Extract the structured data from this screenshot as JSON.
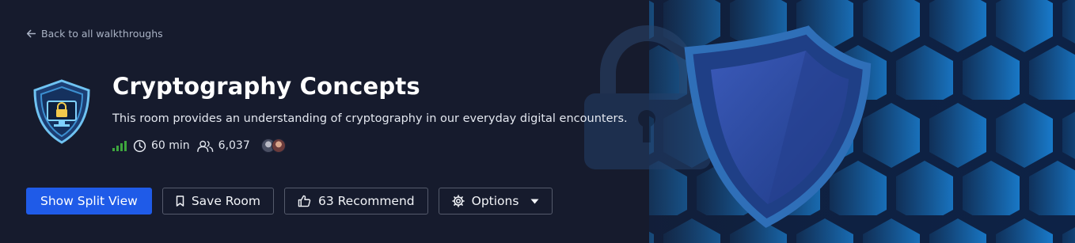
{
  "back_link": {
    "label": "Back to all walkthroughs",
    "icon": "arrow-left-icon"
  },
  "room": {
    "title": "Cryptography Concepts",
    "description": "This room provides an understanding of cryptography in our everyday digital encounters.",
    "difficulty_icon": "signal-bars-icon",
    "duration": "60 min",
    "users_count": "6,037",
    "duration_icon": "clock-icon",
    "users_icon": "users-icon"
  },
  "actions": {
    "split_view": "Show Split View",
    "save_room": "Save Room",
    "recommend": "63 Recommend",
    "options": "Options"
  },
  "colors": {
    "background": "#161b2d",
    "primary_button": "#1f5be8",
    "difficulty": "#3ea63e",
    "hex_pattern": "#1a7fd6"
  }
}
